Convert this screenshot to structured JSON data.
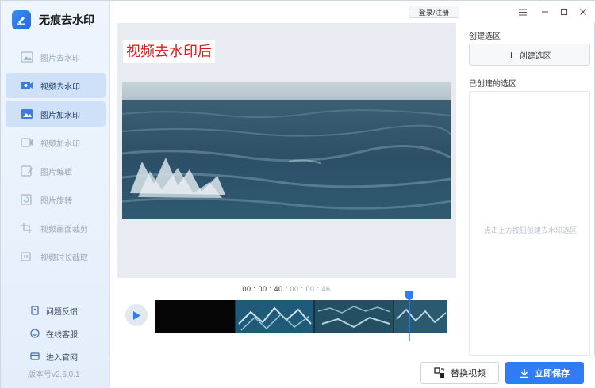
{
  "app": {
    "name": "无痕去水印",
    "version": "版本号v2.6.0.1"
  },
  "sidebar": {
    "items": [
      {
        "label": "图片去水印",
        "icon": "image-erase-icon",
        "active": false
      },
      {
        "label": "视频去水印",
        "icon": "video-erase-icon",
        "active": true
      },
      {
        "label": "图片加水印",
        "icon": "image-watermark-icon",
        "active": true
      },
      {
        "label": "视频加水印",
        "icon": "video-watermark-icon",
        "active": false
      },
      {
        "label": "图片编辑",
        "icon": "image-edit-icon",
        "active": false
      },
      {
        "label": "图片旋转",
        "icon": "image-rotate-icon",
        "active": false
      },
      {
        "label": "视频画面裁剪",
        "icon": "video-crop-icon",
        "active": false
      },
      {
        "label": "视频时长截取",
        "icon": "video-trim-icon",
        "active": false
      }
    ],
    "links": [
      {
        "label": "问题反馈",
        "icon": "feedback-icon"
      },
      {
        "label": "在线客服",
        "icon": "support-icon"
      },
      {
        "label": "进入官网",
        "icon": "website-icon"
      }
    ]
  },
  "titlebar": {
    "login_label": "登录/注册"
  },
  "preview": {
    "overlay_text": "视频去水印后"
  },
  "timeline": {
    "current": "00 : 00 : 40",
    "separator": " / ",
    "total": "00 : 00 : 46",
    "progress": 0.87
  },
  "right_panel": {
    "create_title": "创建选区",
    "create_button": "创建选区",
    "created_title": "已创建的选区",
    "empty_hint": "点击上方按钮创建去水印选区"
  },
  "footer": {
    "replace_label": "替换视频",
    "save_label": "立即保存"
  },
  "colors": {
    "accent": "#2f7cf6",
    "overlay_text": "#e21818"
  }
}
